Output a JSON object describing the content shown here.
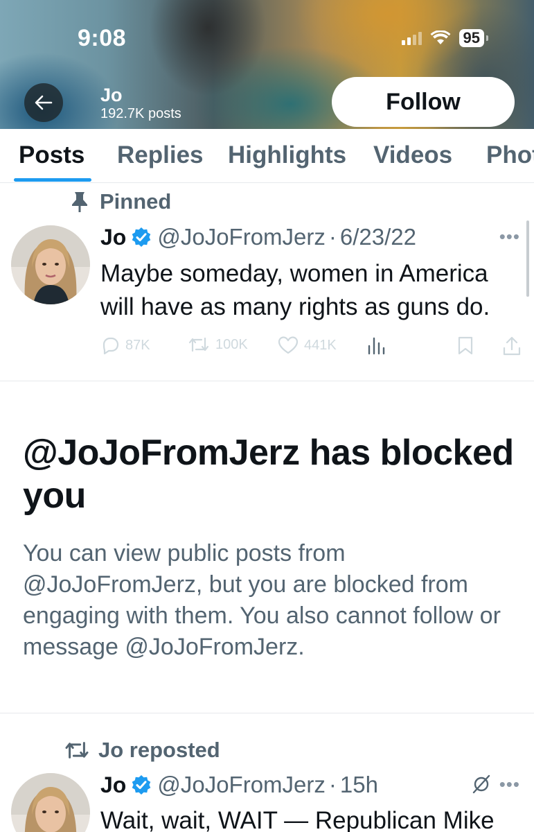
{
  "status_bar": {
    "time": "9:08",
    "battery": "95"
  },
  "profile": {
    "name": "Jo",
    "posts_count": "192.7K posts",
    "follow_label": "Follow"
  },
  "tabs": [
    {
      "label": "Posts",
      "active": true
    },
    {
      "label": "Replies",
      "active": false
    },
    {
      "label": "Highlights",
      "active": false
    },
    {
      "label": "Videos",
      "active": false
    },
    {
      "label": "Photos",
      "active": false
    }
  ],
  "pinned_tweet": {
    "pinned_label": "Pinned",
    "name": "Jo",
    "handle": "@JoJoFromJerz",
    "separator": "·",
    "date": "6/23/22",
    "text": "Maybe someday, women in America will have as many rights as guns do.",
    "replies": "87K",
    "reposts": "100K",
    "likes": "441K"
  },
  "block_notice": {
    "title": "@JoJoFromJerz has blocked you",
    "body": "You can view public posts from @JoJoFromJerz, but you are blocked from engaging with them. You also cannot follow or message @JoJoFromJerz."
  },
  "repost_tweet": {
    "repost_label": "Jo reposted",
    "name": "Jo",
    "handle": "@JoJoFromJerz",
    "separator": "·",
    "time": "15h",
    "text": "Wait, wait, WAIT — Republican Mike"
  },
  "colors": {
    "accent": "#1d9bf0",
    "text_primary": "#0f1419",
    "text_secondary": "#536471",
    "action_grey": "#cfd9de"
  },
  "icons": [
    "back-arrow-icon",
    "signal-icon",
    "wifi-icon",
    "battery-icon",
    "pin-icon",
    "verified-badge-icon",
    "more-icon",
    "reply-icon",
    "repost-icon",
    "like-icon",
    "views-icon",
    "bookmark-icon",
    "share-icon",
    "grok-icon"
  ]
}
